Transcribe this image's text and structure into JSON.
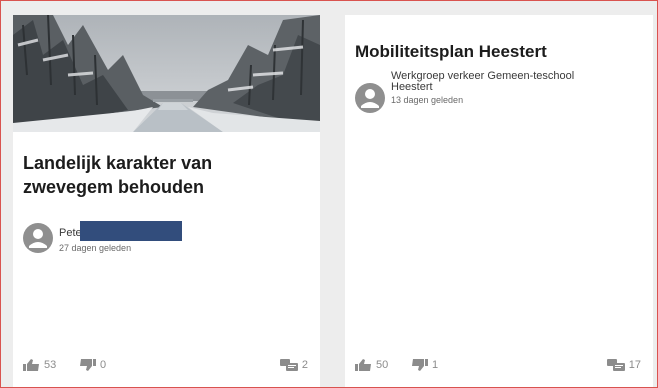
{
  "cards": [
    {
      "title": "Landelijk karakter van zwevegem behouden",
      "author": "Pete",
      "date": "27 dagen geleden",
      "likes": "53",
      "dislikes": "0",
      "comments": "2",
      "icons": {
        "avatar": "user-avatar-icon",
        "like": "thumbs-up-icon",
        "dislike": "thumbs-down-icon",
        "comments": "comments-icon"
      }
    },
    {
      "title": "Mobiliteitsplan Heestert",
      "author": "Werkgroep verkeer Gemeen-teschool Heestert",
      "date": "13 dagen geleden",
      "likes": "50",
      "dislikes": "1",
      "comments": "17",
      "icons": {
        "avatar": "user-avatar-icon",
        "like": "thumbs-up-icon",
        "dislike": "thumbs-down-icon",
        "comments": "comments-icon"
      }
    }
  ],
  "colors": {
    "frame_border": "#d9534f",
    "background": "#ededed",
    "card": "#ffffff",
    "title_text": "#1c1c1c",
    "icon_gray": "#8c8c8c",
    "redaction": "#324d7c"
  }
}
